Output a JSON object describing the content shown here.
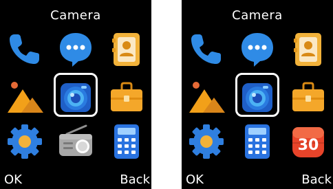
{
  "screens": [
    {
      "title": "Camera",
      "selected_icon": "camera-icon",
      "icons": [
        "phone-icon",
        "messages-icon",
        "contacts-icon",
        "gallery-icon",
        "camera-icon",
        "toolbox-icon",
        "settings-icon",
        "radio-icon",
        "calculator-icon"
      ],
      "softkeys": {
        "left": "OK",
        "right": "Back"
      }
    },
    {
      "title": "Camera",
      "selected_icon": "camera-icon",
      "icons": [
        "phone-icon",
        "messages-icon",
        "contacts-icon",
        "gallery-icon",
        "camera-icon",
        "toolbox-icon",
        "settings-icon",
        "calculator-icon",
        "calendar-icon"
      ],
      "calendar_day": "30",
      "softkeys": {
        "left": "OK",
        "right": "Back"
      }
    }
  ],
  "colors": {
    "background": "#000000",
    "text": "#ffffff",
    "selection_border": "#ffffff",
    "phone": "#2f8be6",
    "messages": "#2f8be6",
    "contacts": "#f2b23a",
    "gallery": "#f2a019",
    "camera": "#2a7be0",
    "toolbox": "#f4a72a",
    "settings": "#2f7fe0",
    "radio": "#a8a8a8",
    "calculator": "#2a73e0",
    "calendar": "#e8442a"
  }
}
